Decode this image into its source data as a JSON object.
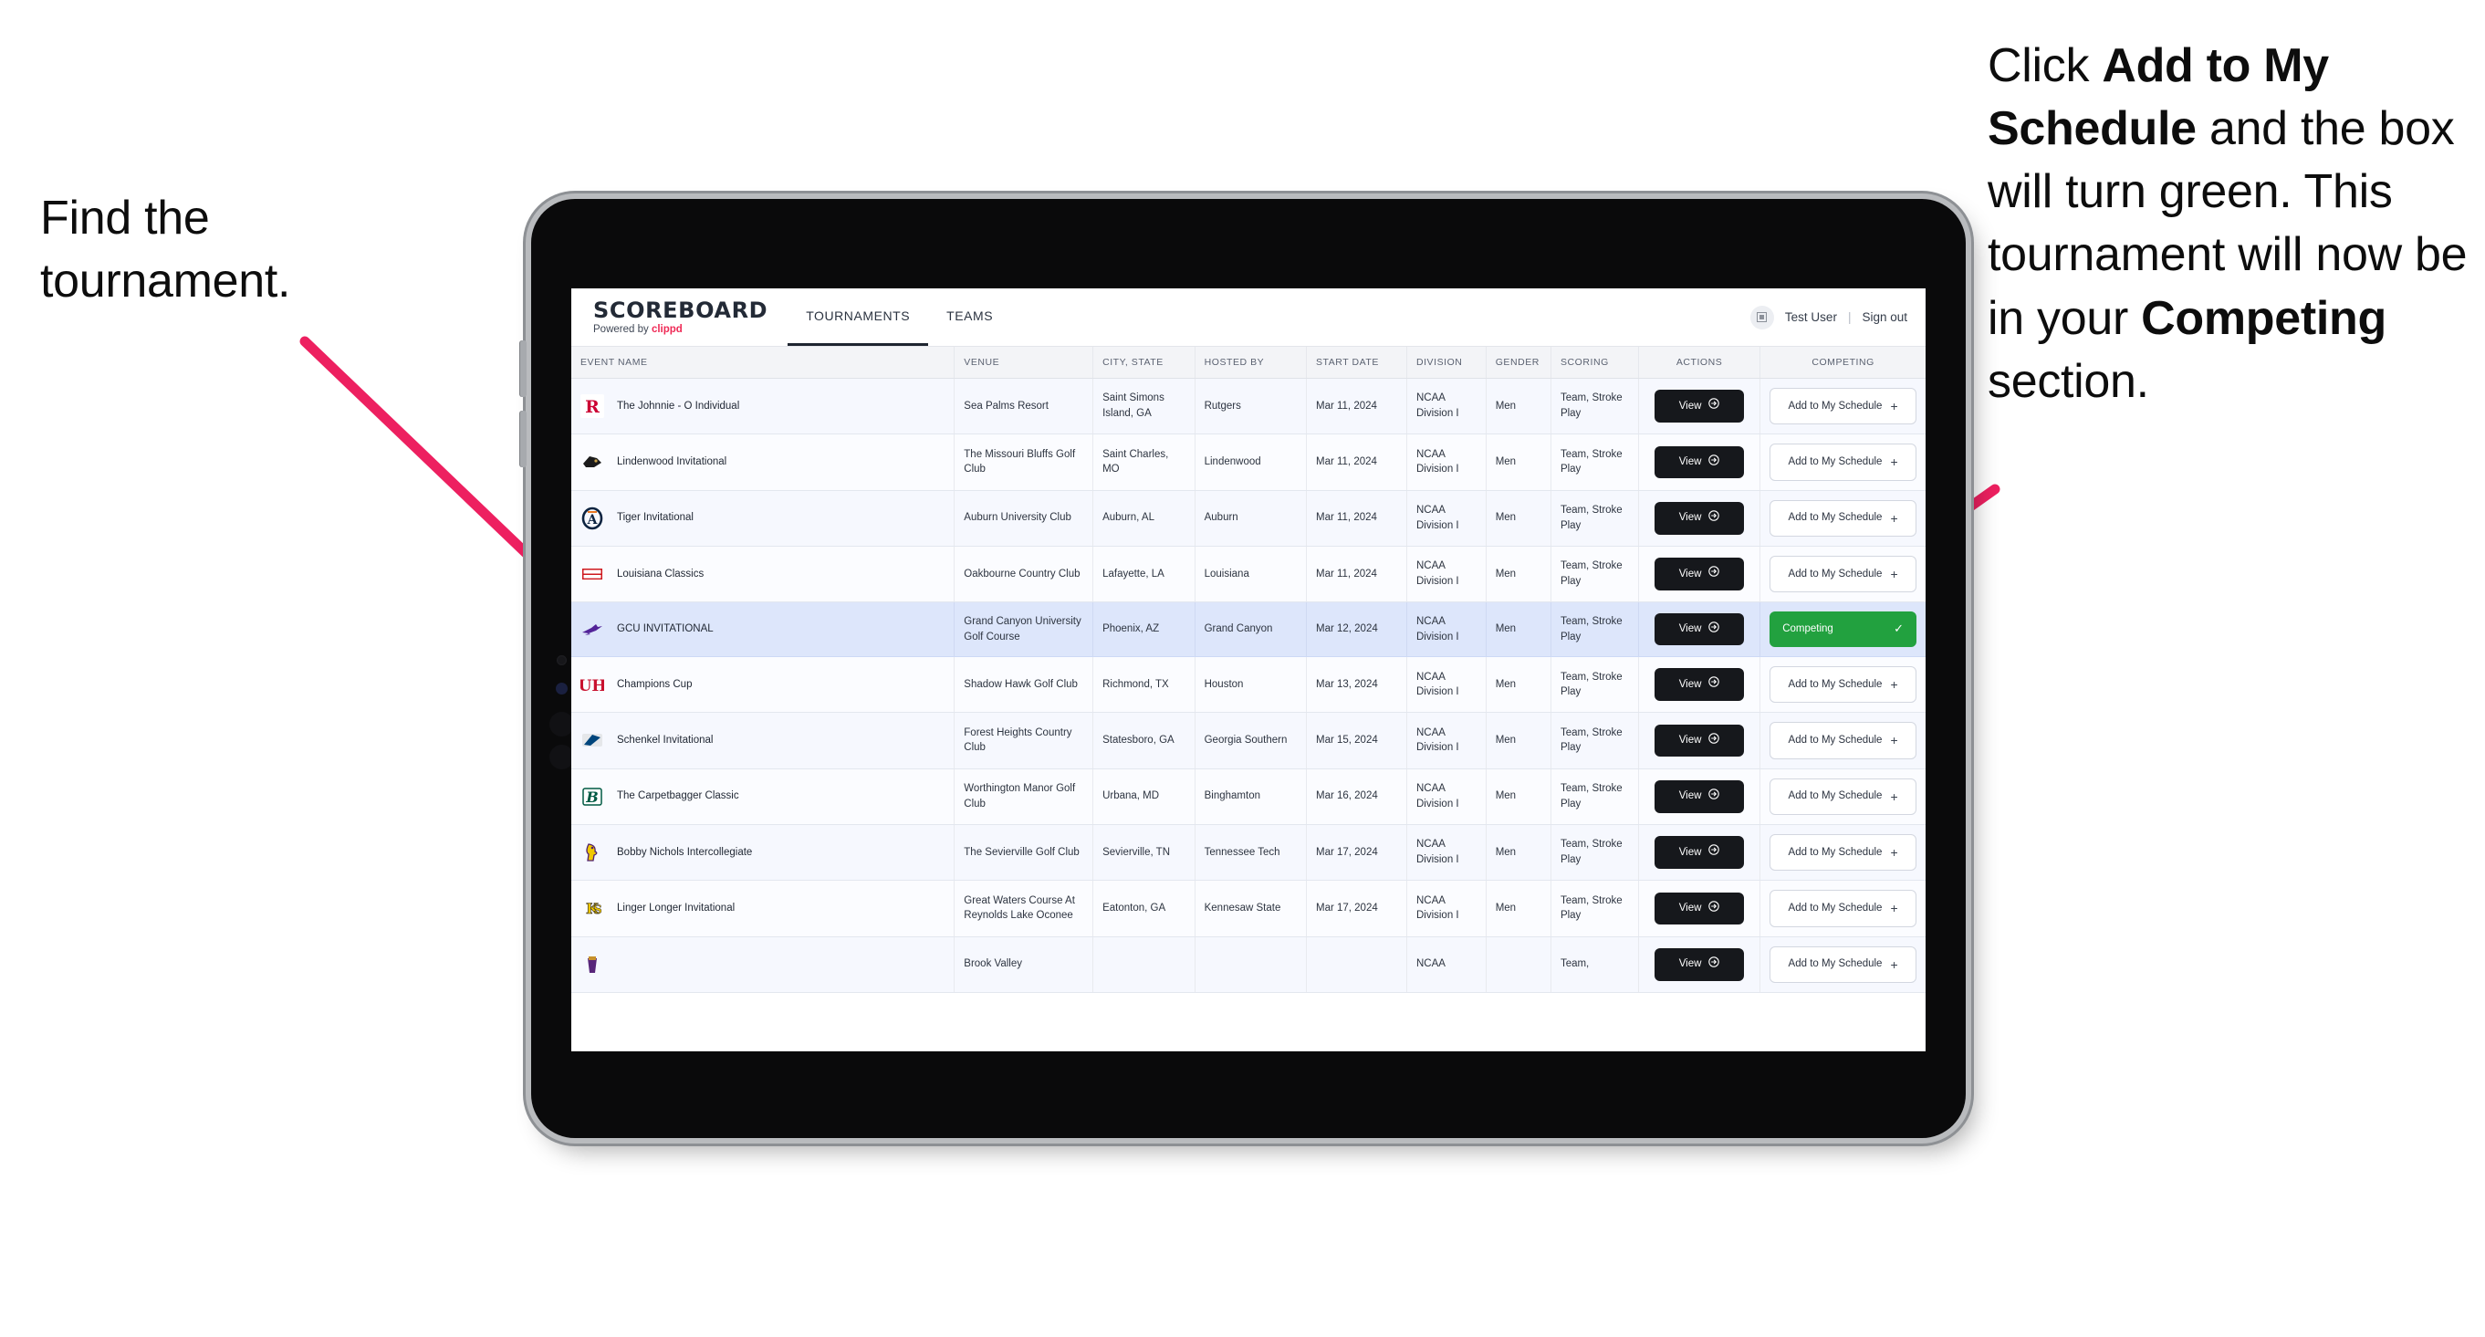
{
  "annotations": {
    "left": "Find the tournament.",
    "right_parts": [
      {
        "text": "Click ",
        "bold": false
      },
      {
        "text": "Add to My Schedule",
        "bold": true
      },
      {
        "text": " and the box will turn green. This tournament will now be in your ",
        "bold": false
      },
      {
        "text": "Competing",
        "bold": true
      },
      {
        "text": " section.",
        "bold": false
      }
    ],
    "arrow_color": "#ED2060"
  },
  "app": {
    "brand": {
      "title": "SCOREBOARD",
      "sub_prefix": "Powered by ",
      "sub_brand": "clippd"
    },
    "nav": [
      {
        "label": "TOURNAMENTS",
        "active": true
      },
      {
        "label": "TEAMS",
        "active": false
      }
    ],
    "user": {
      "avatar_icon": "user-avatar-icon",
      "name": "Test User",
      "divider": "|",
      "signout": "Sign out"
    }
  },
  "table": {
    "columns": [
      "EVENT NAME",
      "VENUE",
      "CITY, STATE",
      "HOSTED BY",
      "START DATE",
      "DIVISION",
      "GENDER",
      "SCORING",
      "ACTIONS",
      "COMPETING"
    ],
    "view_label": "View",
    "add_label": "Add to My Schedule",
    "competing_label": "Competing",
    "rows": [
      {
        "logo": "rutgers-logo",
        "event": "The Johnnie - O Individual",
        "venue": "Sea Palms Resort",
        "city": "Saint Simons Island, GA",
        "host": "Rutgers",
        "date": "Mar 11, 2024",
        "division": "NCAA Division I",
        "gender": "Men",
        "scoring": "Team, Stroke Play",
        "competing": false
      },
      {
        "logo": "lindenwood-logo",
        "event": "Lindenwood Invitational",
        "venue": "The Missouri Bluffs Golf Club",
        "city": "Saint Charles, MO",
        "host": "Lindenwood",
        "date": "Mar 11, 2024",
        "division": "NCAA Division I",
        "gender": "Men",
        "scoring": "Team, Stroke Play",
        "competing": false
      },
      {
        "logo": "auburn-logo",
        "event": "Tiger Invitational",
        "venue": "Auburn University Club",
        "city": "Auburn, AL",
        "host": "Auburn",
        "date": "Mar 11, 2024",
        "division": "NCAA Division I",
        "gender": "Men",
        "scoring": "Team, Stroke Play",
        "competing": false
      },
      {
        "logo": "louisiana-logo",
        "event": "Louisiana Classics",
        "venue": "Oakbourne Country Club",
        "city": "Lafayette, LA",
        "host": "Louisiana",
        "date": "Mar 11, 2024",
        "division": "NCAA Division I",
        "gender": "Men",
        "scoring": "Team, Stroke Play",
        "competing": false
      },
      {
        "logo": "grandcanyon-logo",
        "event": "GCU INVITATIONAL",
        "venue": "Grand Canyon University Golf Course",
        "city": "Phoenix, AZ",
        "host": "Grand Canyon",
        "date": "Mar 12, 2024",
        "division": "NCAA Division I",
        "gender": "Men",
        "scoring": "Team, Stroke Play",
        "competing": true
      },
      {
        "logo": "houston-logo",
        "event": "Champions Cup",
        "venue": "Shadow Hawk Golf Club",
        "city": "Richmond, TX",
        "host": "Houston",
        "date": "Mar 13, 2024",
        "division": "NCAA Division I",
        "gender": "Men",
        "scoring": "Team, Stroke Play",
        "competing": false
      },
      {
        "logo": "georgiasouthern-logo",
        "event": "Schenkel Invitational",
        "venue": "Forest Heights Country Club",
        "city": "Statesboro, GA",
        "host": "Georgia Southern",
        "date": "Mar 15, 2024",
        "division": "NCAA Division I",
        "gender": "Men",
        "scoring": "Team, Stroke Play",
        "competing": false
      },
      {
        "logo": "binghamton-logo",
        "event": "The Carpetbagger Classic",
        "venue": "Worthington Manor Golf Club",
        "city": "Urbana, MD",
        "host": "Binghamton",
        "date": "Mar 16, 2024",
        "division": "NCAA Division I",
        "gender": "Men",
        "scoring": "Team, Stroke Play",
        "competing": false
      },
      {
        "logo": "tennesseetech-logo",
        "event": "Bobby Nichols Intercollegiate",
        "venue": "The Sevierville Golf Club",
        "city": "Sevierville, TN",
        "host": "Tennessee Tech",
        "date": "Mar 17, 2024",
        "division": "NCAA Division I",
        "gender": "Men",
        "scoring": "Team, Stroke Play",
        "competing": false
      },
      {
        "logo": "kennesaw-logo",
        "event": "Linger Longer Invitational",
        "venue": "Great Waters Course At Reynolds Lake Oconee",
        "city": "Eatonton, GA",
        "host": "Kennesaw State",
        "date": "Mar 17, 2024",
        "division": "NCAA Division I",
        "gender": "Men",
        "scoring": "Team, Stroke Play",
        "competing": false
      },
      {
        "logo": "partial-logo",
        "event": "",
        "venue": "Brook Valley",
        "city": "",
        "host": "",
        "date": "",
        "division": "NCAA",
        "gender": "",
        "scoring": "Team,",
        "competing": false
      }
    ]
  }
}
